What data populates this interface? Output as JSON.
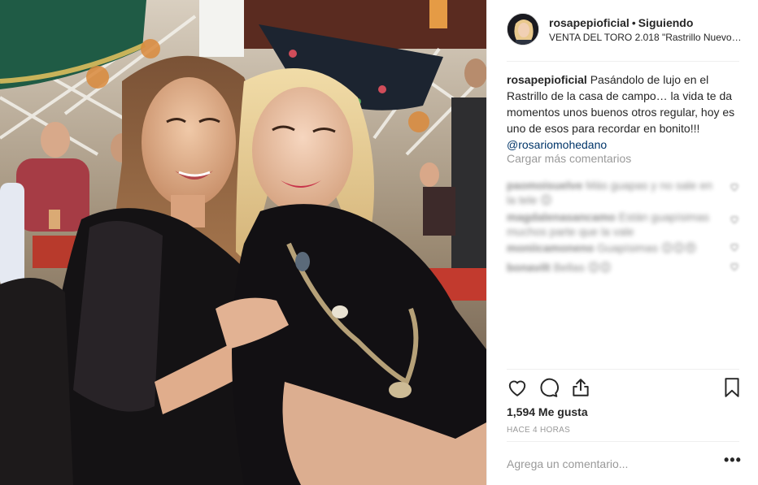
{
  "post": {
    "header": {
      "username": "rosapepioficial",
      "separator": "•",
      "follow_status": "Siguiendo",
      "location": "VENTA DEL TORO 2.018 \"Rastrillo Nuevo F..."
    },
    "caption": {
      "username": "rosapepioficial",
      "text": "Pasándolo de lujo en el Rastrillo de la casa de campo… la vida te da momentos unos buenos otros regular, hoy es uno de esos para recordar en bonito!!!",
      "mention": "@rosariomohedano"
    },
    "load_more_label": "Cargar más comentarios",
    "comments": [
      {
        "username": "paomoisuelve",
        "text": "Más guapas y no sale en la tele 😊"
      },
      {
        "username": "magdalenasancamo",
        "text": "Están guapísimas muchos parte que la vale"
      },
      {
        "username": "moniicamoneno",
        "text": "Guapísimas 😊😊😍"
      },
      {
        "username": "bonavilt",
        "text": "Bellas 😊😊"
      }
    ],
    "likes": "1,594 Me gusta",
    "timestamp": "HACE 4 HORAS",
    "comment_placeholder": "Agrega un comentario...",
    "more_label": "•••"
  },
  "icons": {
    "like": "heart-icon",
    "comment": "comment-bubble-icon",
    "share": "share-icon",
    "save": "bookmark-icon",
    "options": "more-options-icon"
  },
  "colors": {
    "text": "#262626",
    "muted": "#999999",
    "mention": "#003569",
    "border": "#efefef"
  }
}
